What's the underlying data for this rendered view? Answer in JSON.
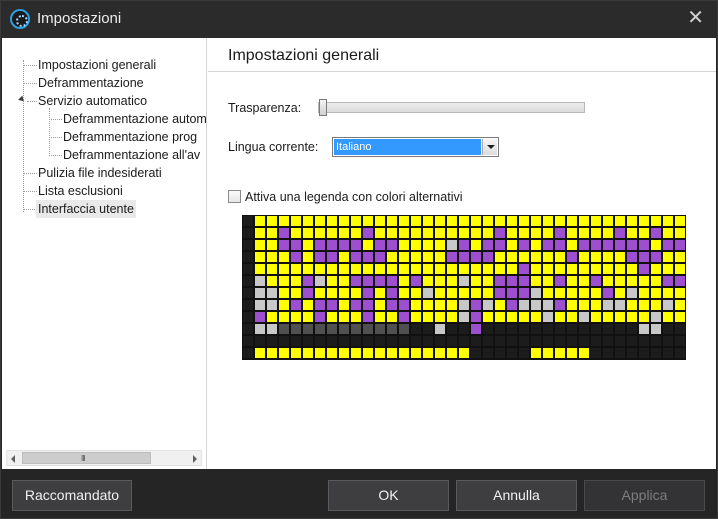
{
  "window": {
    "title": "Impostazioni",
    "icon": "defrag-app-icon",
    "close_icon": "close-icon",
    "close_glyph": "✕"
  },
  "sidebar": {
    "items": [
      {
        "label": "Impostazioni generali",
        "level": 0
      },
      {
        "label": "Deframmentazione",
        "level": 0
      },
      {
        "label": "Servizio automatico",
        "level": 0,
        "expanded": true
      },
      {
        "label": "Deframmentazione automatica",
        "visible_text": "Deframmentazione autom",
        "level": 1
      },
      {
        "label": "Deframmentazione programmata",
        "visible_text": "Deframmentazione prog",
        "level": 1
      },
      {
        "label": "Deframmentazione all'avvio",
        "visible_text": "Deframmentazione all'av",
        "level": 1
      },
      {
        "label": "Pulizia file indesiderati",
        "level": 0
      },
      {
        "label": "Lista esclusioni",
        "level": 0
      },
      {
        "label": "Interfaccia utente",
        "level": 0,
        "selected": true
      }
    ],
    "scrollbar_grip": "III"
  },
  "main": {
    "title": "Impostazioni generali",
    "transparency": {
      "label": "Trasparenza:",
      "value": 0
    },
    "language": {
      "label": "Lingua corrente:",
      "selected": "Italiano"
    },
    "alt_legend": {
      "label": "Attiva una legenda con colori alternativi",
      "checked": false
    },
    "cluster_map": {
      "colors": {
        "Y": "#ffff00",
        "P": "#9d4fd0",
        "G": "#c8c8c8",
        "D": "#505050",
        "B": "#1c1c1c"
      },
      "rows": [
        "BYYYYYYYYYYYYYYYYYYYYYYYYYYYYYYYYYYYYYYYYYYYYYYYYYYYYGYYYY",
        "BYYPYYYYYYPYYYYYYYYYYPYYYYPYYYYPYYPYYYYYYYYPYYYYYYYYYYYGY",
        "BYYPPYPPPPYPPYYYYGPYPPYPYPPYPPPPPPYPPPPPYPPPPPPPPPPYPPPY",
        "BYYYPYPPYPPPYYYYYPPPPYYYYYYPYYYYPPPYYPPPYYPYYPYYYYYYGYYP",
        "BYYYYYYYYYYYYYYYYYYYYYYPYYYYYYYYYPYYYYYYYYYYYYYYYYYYYYYY",
        "BGYYYPGYYPPPPYPYYYGYYPPPYYPYYPYYYYYPPYGYYPYYYYYYYYYYYYYY",
        "BGGYYPYYYYPYPYYGYYYYYPPPGYYYYYPYGYYYYYGYGPYYYYYYGYYYGYYY",
        "BGGYPYPPYPPYPPYYYYGPGYPGGGPYYYGGYYYGYGPYPYGGGGGYGGGYPGY",
        "BPYYYYPYYYPYYPYYYYGPYYYYYGYYGYYYYYGYYGPYYPYGYYYYYYYYYYYY",
        "BGGDDDDDDDDDDDBBGBBPBBBBBBBBBBBBBGGBBBBBBBBBBBBBBBBBBBBBYY",
        "BBBBBBBBBBBBBBBBBBBBBBBBBBBBBBBBBBBBBBBBPGBBBBBBBBBBBGGGGY",
        "BYYYYYYYYYYYYYYYYYYBBBBBYYYYYBBBBBBBBBBBBBBBBBGBBYYYYYYYYYY",
        "BBBBBBBBBBBBBBBBBBBBBBBBBBBBBGBBBBBBBBBBBBYYYYBBBBBBBBBBBP"
      ]
    }
  },
  "footer": {
    "recommended": "Raccomandato",
    "ok": "OK",
    "cancel": "Annulla",
    "apply": "Applica"
  }
}
